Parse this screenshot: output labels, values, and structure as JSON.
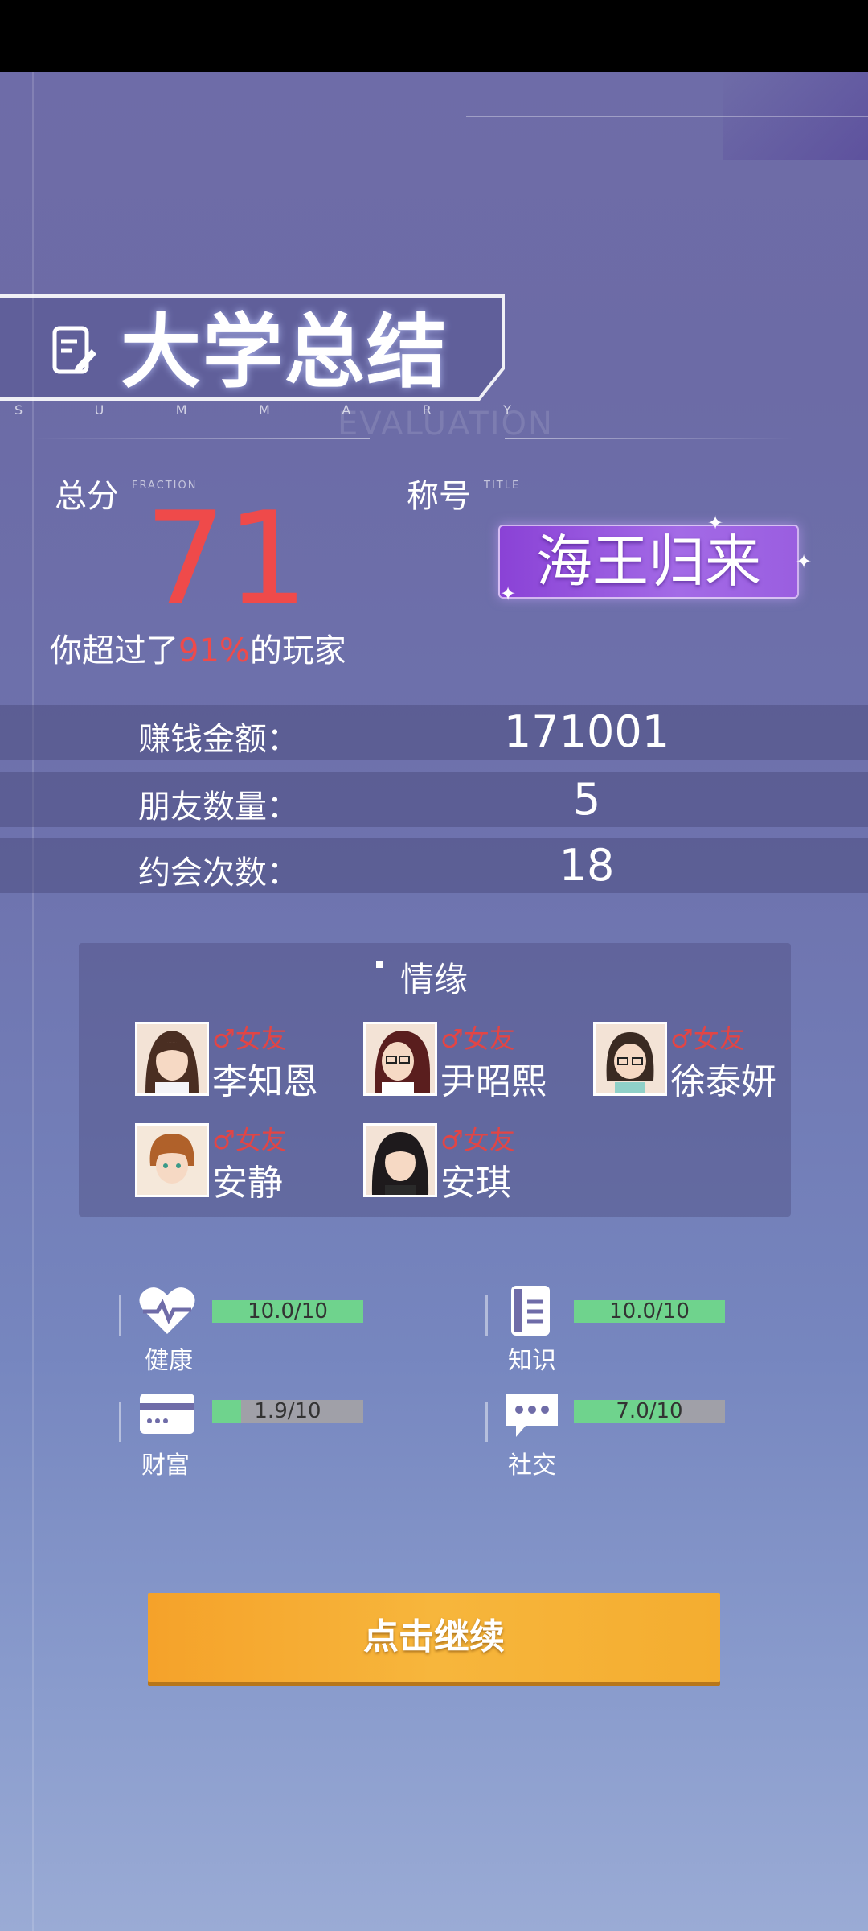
{
  "header": {
    "title": "大学总结",
    "summary_letters": [
      "S",
      "U",
      "M",
      "M",
      "A",
      "R",
      "Y"
    ],
    "evaluation": "EVALUATION"
  },
  "score": {
    "label": "总分",
    "tag": "FRACTION",
    "value": "71",
    "exceed_prefix": "你超过了",
    "exceed_pct": "91%",
    "exceed_suffix": "的玩家"
  },
  "title_badge": {
    "label": "称号",
    "tag": "TITLE",
    "value": "海王归来"
  },
  "stats": [
    {
      "label": "赚钱金额：",
      "value": "171001"
    },
    {
      "label": "朋友数量：",
      "value": "5"
    },
    {
      "label": "约会次数：",
      "value": "18"
    }
  ],
  "relationships": {
    "title": "情缘",
    "items": [
      {
        "tag": "♂女友",
        "name": "李知恩"
      },
      {
        "tag": "♂女友",
        "name": "尹昭熙"
      },
      {
        "tag": "♂女友",
        "name": "徐泰妍"
      },
      {
        "tag": "♂女友",
        "name": "安静"
      },
      {
        "tag": "♂女友",
        "name": "安琪"
      }
    ]
  },
  "attributes": [
    {
      "label": "健康",
      "icon": "heart-icon",
      "text": "10.0/10",
      "fraction": 1.0
    },
    {
      "label": "知识",
      "icon": "book-icon",
      "text": "10.0/10",
      "fraction": 1.0
    },
    {
      "label": "财富",
      "icon": "card-icon",
      "text": "1.9/10",
      "fraction": 0.19
    },
    {
      "label": "社交",
      "icon": "chat-icon",
      "text": "7.0/10",
      "fraction": 0.7
    }
  ],
  "continue_button": "点击继续"
}
